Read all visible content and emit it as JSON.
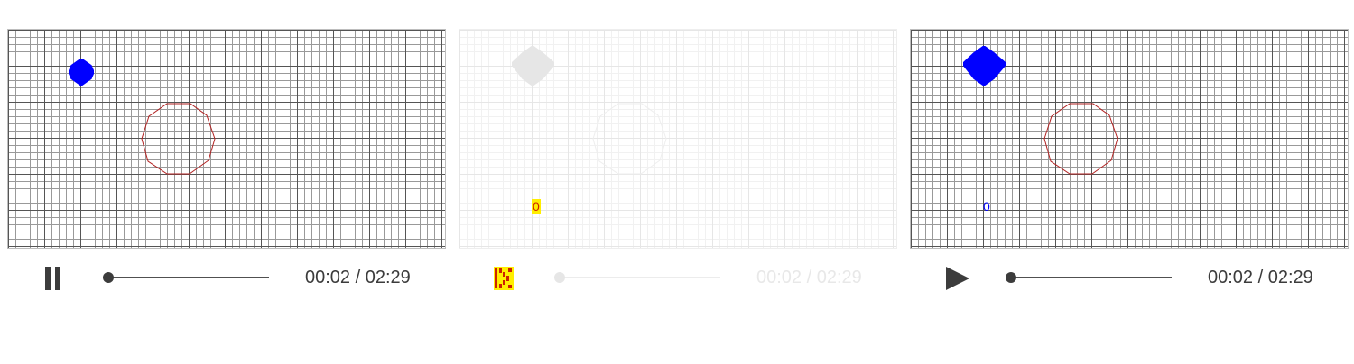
{
  "players": [
    {
      "id": "player-1",
      "state": "playing",
      "button_icon": "pause-icon",
      "time_display": "00:02 / 02:29",
      "progress_fraction": 0.013,
      "counter": "",
      "style": "normal"
    },
    {
      "id": "player-2",
      "state": "faded",
      "button_icon": "glitched-icon",
      "time_display": "00:02 / 02:29",
      "progress_fraction": 0.013,
      "counter": "0",
      "style": "faded"
    },
    {
      "id": "player-3",
      "state": "paused",
      "button_icon": "play-icon",
      "time_display": "00:02 / 02:29",
      "progress_fraction": 0.013,
      "counter": "0",
      "style": "normal"
    }
  ],
  "colors": {
    "filled_circle": "#0000ff",
    "outline_shape": "#b22222",
    "control_gray": "#3c3c3c",
    "glitch_yellow": "#ffee00",
    "glitch_red": "#cc2200"
  }
}
